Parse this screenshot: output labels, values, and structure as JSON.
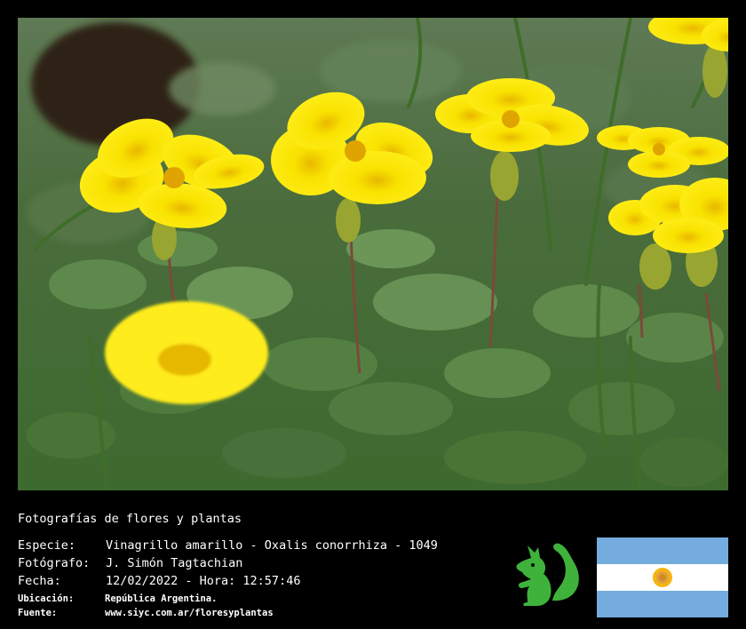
{
  "header": "Fotografías de flores y plantas",
  "fields": [
    {
      "label": "Especie:",
      "value": "Vinagrillo amarillo - Oxalis conorrhiza - 1049"
    },
    {
      "label": "Fotógrafo:",
      "value": "J. Simón Tagtachian"
    },
    {
      "label": "Fecha:",
      "value": "12/02/2022 - Hora: 12:57:46"
    },
    {
      "label": "Ubicación:",
      "value": "República Argentina."
    },
    {
      "label": "Fuente:",
      "value": "www.siyc.com.ar/floresyplantas"
    }
  ],
  "colors": {
    "flower": "#f7e400",
    "leaf": "#4f7f3a",
    "mascot": "#3fb23c",
    "flag_blue": "#74acdf",
    "flag_white": "#ffffff",
    "sun": "#f6b40e"
  },
  "icons": {
    "mascot": "green-squirrel-icon",
    "flag": "argentina-flag-icon"
  }
}
